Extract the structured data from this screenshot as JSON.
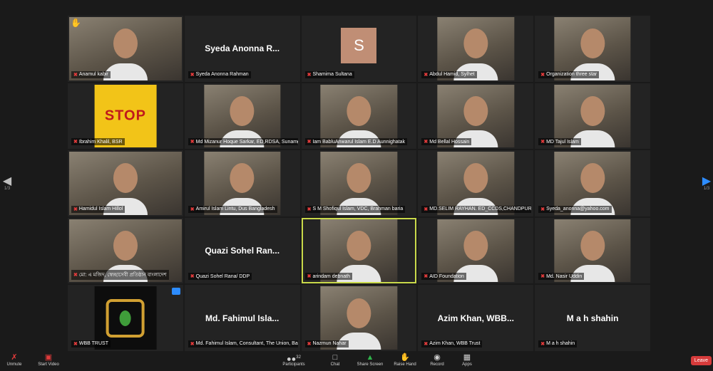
{
  "tiles": [
    {
      "name": "Anamul kabir",
      "type": "video",
      "raised_hand": true
    },
    {
      "name": "Syeda Anonna Rahman",
      "type": "label",
      "display": "Syeda Anonna R..."
    },
    {
      "name": "Shamima Sultana",
      "type": "avatar",
      "initial": "S"
    },
    {
      "name": "Abdul Hamid, Sylhet",
      "type": "video"
    },
    {
      "name": "Organization three star",
      "type": "video"
    },
    {
      "name": "Ibrahim Khalil, BSR",
      "type": "poster",
      "poster_text": "STOP"
    },
    {
      "name": "Md Mizanur Hoque Sarkar, ED,RDSA, Sunamgonj",
      "type": "video"
    },
    {
      "name": "Iam BabluAnwarul Islam E.D Aunnighatak",
      "type": "video"
    },
    {
      "name": "Md Bellal Hossain",
      "type": "video"
    },
    {
      "name": "MD Tajul Islam",
      "type": "video"
    },
    {
      "name": "Hamidul Islam Hillol",
      "type": "video"
    },
    {
      "name": "Amirul Islam Lintu, Dus Bangladesh",
      "type": "video"
    },
    {
      "name": "S M Shofiqul Islam, VDC, Brahman baria",
      "type": "video"
    },
    {
      "name": "MD.SELIM RAYHAN. ED_CCDS,CHANDPUR.",
      "type": "video"
    },
    {
      "name": "Syeda_anonna@yahoo.com",
      "type": "video"
    },
    {
      "name": "মো: এ মজিদ, স্বেচ্ছাসেবী প্রতিষ্ঠান বাংলাদেশ",
      "type": "video"
    },
    {
      "name": "Quazi Sohel Rana/ DDP",
      "type": "label",
      "display": "Quazi Sohel Ran..."
    },
    {
      "name": "arindam debnath",
      "type": "video",
      "active": true
    },
    {
      "name": "AID Foundation",
      "type": "video"
    },
    {
      "name": "Md. Nasir Uddin",
      "type": "video"
    },
    {
      "name": "WBB TRUST",
      "type": "logo",
      "corner_badge": true
    },
    {
      "name": "Md. Fahimul Islam, Consultant, The Union, Bangladesh",
      "type": "label",
      "display": "Md. Fahimul Isla..."
    },
    {
      "name": "Nazmun Nahar",
      "type": "video"
    },
    {
      "name": "Azim Khan, WBB Trust",
      "type": "label",
      "display": "Azim Khan, WBB..."
    },
    {
      "name": "M a h shahin",
      "type": "label",
      "display": "M a h shahin"
    }
  ],
  "pagination": {
    "left": "1/3",
    "right": "1/3"
  },
  "toolbar": {
    "unmute": "Unmute",
    "start_video": "Start Video",
    "participants": "Participants",
    "participants_count": "32",
    "chat": "Chat",
    "share_screen": "Share Screen",
    "raise_hand": "Raise Hand",
    "record": "Record",
    "apps": "Apps",
    "leave": "Leave"
  },
  "colors": {
    "active_speaker": "#c9d94a",
    "leave": "#d63b3b",
    "share": "#2fb34a",
    "muted": "#e23b3b"
  }
}
